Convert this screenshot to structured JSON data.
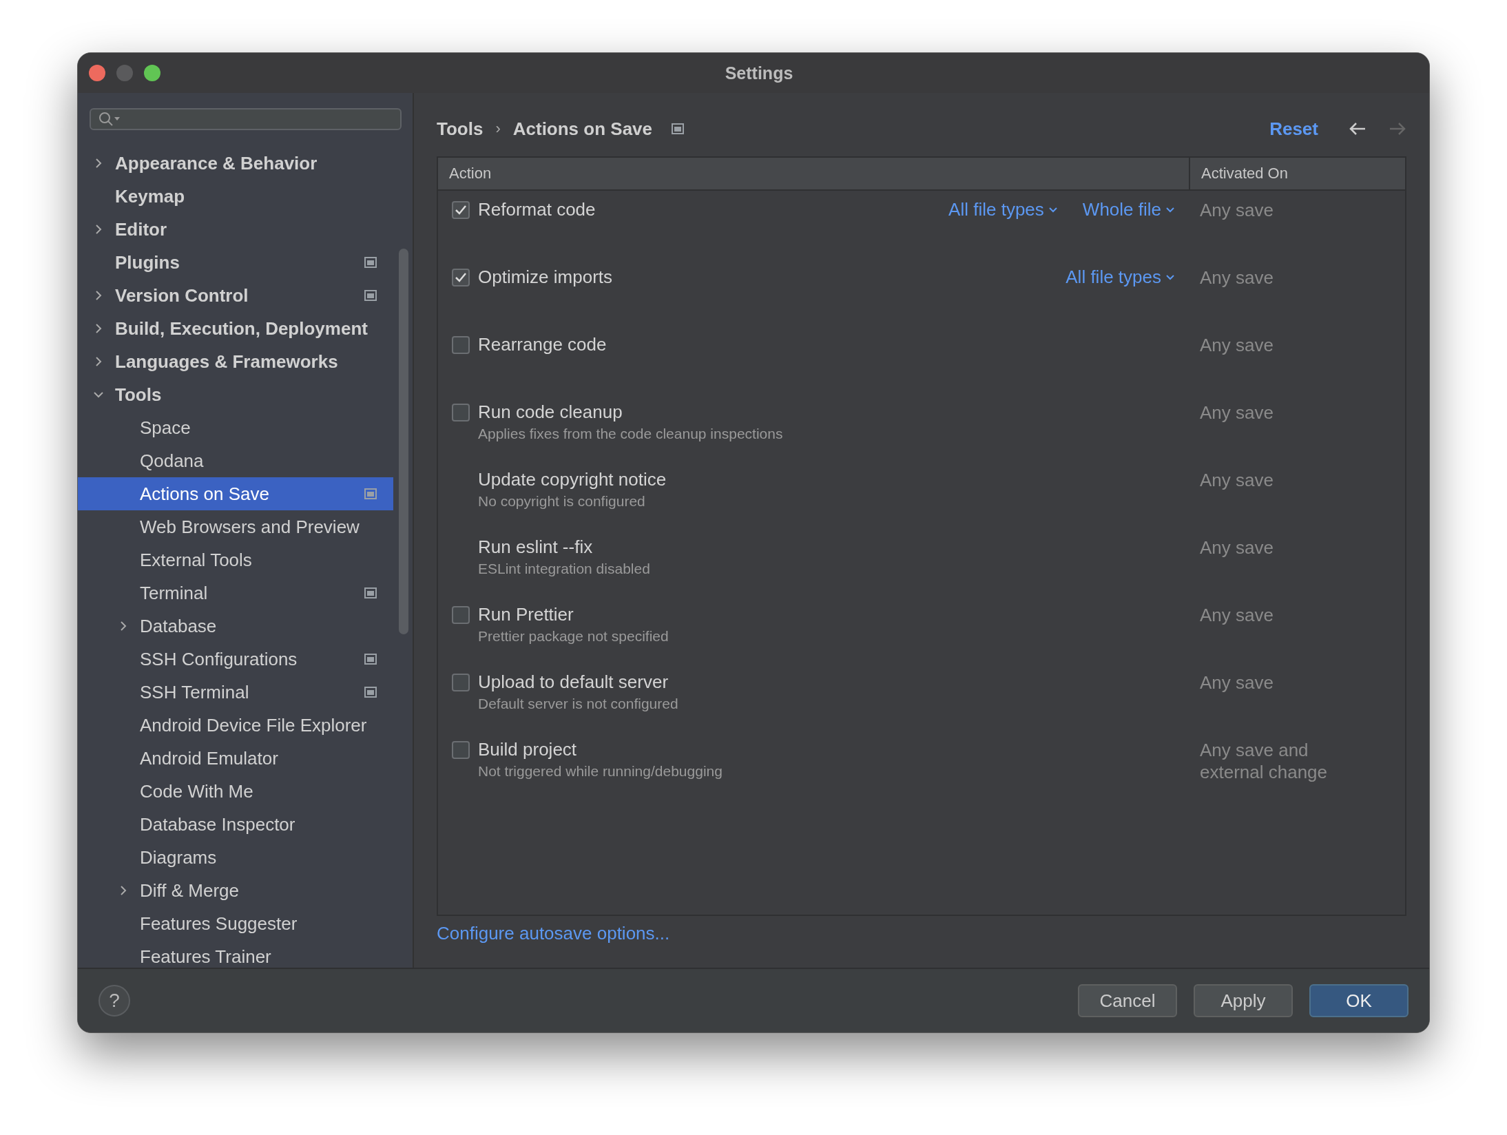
{
  "window": {
    "title": "Settings"
  },
  "sidebar": {
    "items": [
      {
        "label": "Appearance & Behavior",
        "expanded": false,
        "badge": false,
        "selected": false
      },
      {
        "label": "Keymap",
        "badge": false,
        "selected": false
      },
      {
        "label": "Editor",
        "expanded": false,
        "badge": false,
        "selected": false
      },
      {
        "label": "Plugins",
        "badge": true,
        "selected": false
      },
      {
        "label": "Version Control",
        "expanded": false,
        "badge": true,
        "selected": false
      },
      {
        "label": "Build, Execution, Deployment",
        "expanded": false,
        "badge": false,
        "selected": false
      },
      {
        "label": "Languages & Frameworks",
        "expanded": false,
        "badge": false,
        "selected": false
      },
      {
        "label": "Tools",
        "expanded": true,
        "badge": false,
        "selected": false,
        "children": [
          {
            "label": "Space",
            "badge": false,
            "selected": false
          },
          {
            "label": "Qodana",
            "badge": false,
            "selected": false
          },
          {
            "label": "Actions on Save",
            "badge": true,
            "selected": true
          },
          {
            "label": "Web Browsers and Preview",
            "badge": false,
            "selected": false
          },
          {
            "label": "External Tools",
            "badge": false,
            "selected": false
          },
          {
            "label": "Terminal",
            "badge": true,
            "selected": false
          },
          {
            "label": "Database",
            "expanded": false,
            "badge": false,
            "selected": false
          },
          {
            "label": "SSH Configurations",
            "badge": true,
            "selected": false
          },
          {
            "label": "SSH Terminal",
            "badge": true,
            "selected": false
          },
          {
            "label": "Android Device File Explorer",
            "badge": false,
            "selected": false
          },
          {
            "label": "Android Emulator",
            "badge": false,
            "selected": false
          },
          {
            "label": "Code With Me",
            "badge": false,
            "selected": false
          },
          {
            "label": "Database Inspector",
            "badge": false,
            "selected": false
          },
          {
            "label": "Diagrams",
            "badge": false,
            "selected": false
          },
          {
            "label": "Diff & Merge",
            "expanded": false,
            "badge": false,
            "selected": false
          },
          {
            "label": "Features Suggester",
            "badge": false,
            "selected": false
          },
          {
            "label": "Features Trainer",
            "badge": false,
            "selected": false
          }
        ]
      }
    ]
  },
  "header": {
    "breadcrumb": [
      "Tools",
      "Actions on Save"
    ],
    "separator": "›",
    "badge": true,
    "reset": "Reset"
  },
  "table": {
    "columns": [
      "Action",
      "Activated On"
    ],
    "rows": [
      {
        "kind": "checkbox",
        "checked": true,
        "title": "Reformat code",
        "options": [
          "All file types",
          "Whole file"
        ],
        "activated_on": "Any save"
      },
      {
        "kind": "checkbox",
        "checked": true,
        "title": "Optimize imports",
        "options": [
          "All file types"
        ],
        "activated_on": "Any save"
      },
      {
        "kind": "checkbox",
        "checked": false,
        "title": "Rearrange code",
        "activated_on": "Any save"
      },
      {
        "kind": "checkbox",
        "checked": false,
        "title": "Run code cleanup",
        "description": "Applies fixes from the code cleanup inspections",
        "activated_on": "Any save"
      },
      {
        "kind": "plain",
        "title": "Update copyright notice",
        "description": "No copyright is configured",
        "activated_on": "Any save"
      },
      {
        "kind": "plain",
        "title": "Run eslint --fix",
        "description": "ESLint integration disabled",
        "activated_on": "Any save"
      },
      {
        "kind": "checkbox",
        "checked": false,
        "title": "Run Prettier",
        "description": "Prettier package not specified",
        "activated_on": "Any save"
      },
      {
        "kind": "checkbox",
        "checked": false,
        "title": "Upload to default server",
        "description": "Default server is not configured",
        "activated_on": "Any save"
      },
      {
        "kind": "checkbox",
        "checked": false,
        "title": "Build project",
        "description": "Not triggered while running/debugging",
        "activated_on": "Any save and external change"
      }
    ]
  },
  "link": "Configure autosave options...",
  "footer": {
    "help": "?",
    "buttons": [
      {
        "label": "Cancel",
        "primary": false
      },
      {
        "label": "Apply",
        "primary": false
      },
      {
        "label": "OK",
        "primary": true
      }
    ]
  }
}
